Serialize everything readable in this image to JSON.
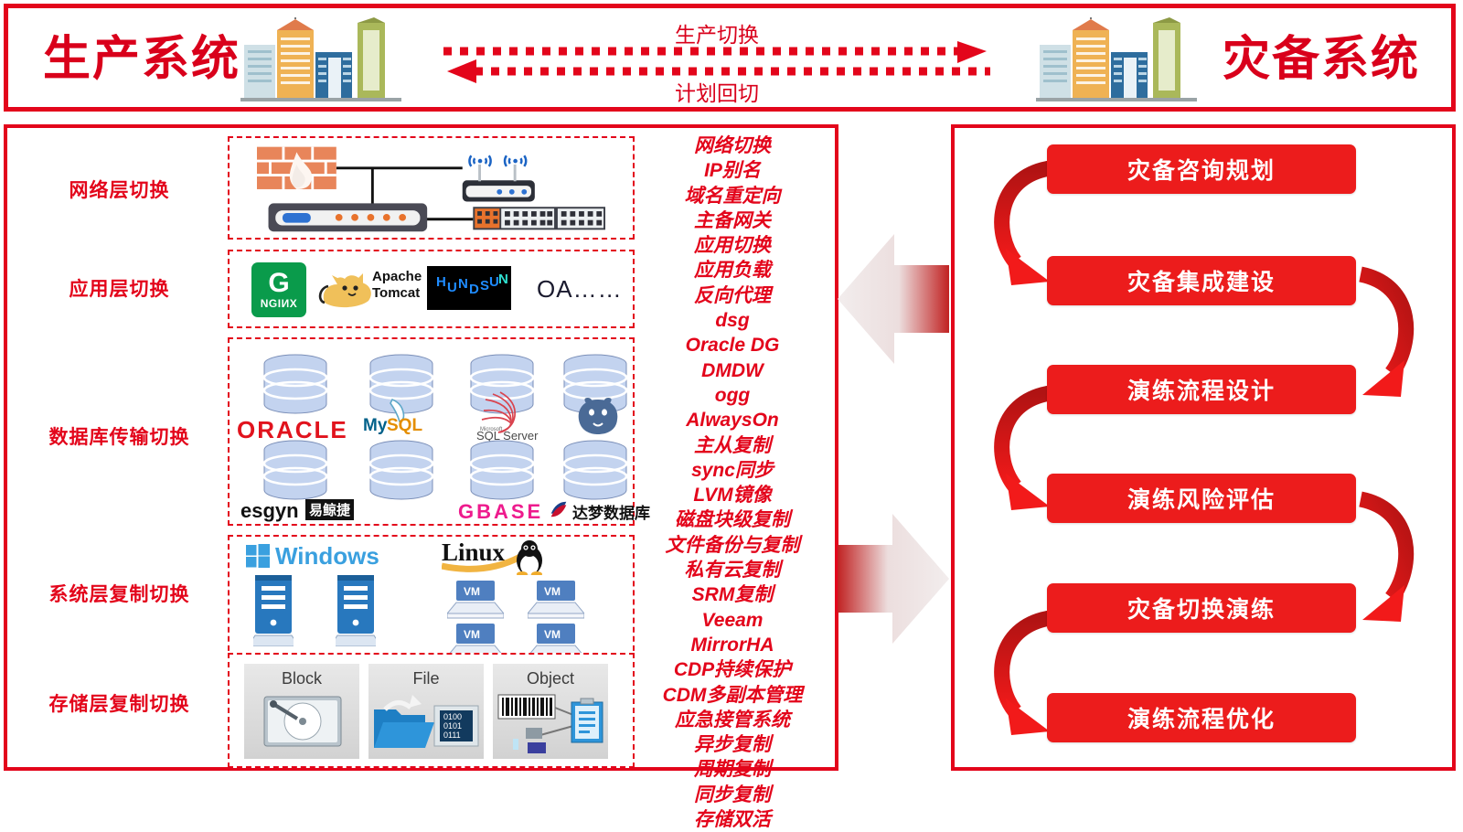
{
  "header": {
    "left_title": "生产系统",
    "right_title": "灾备系统",
    "arrow_top_label": "生产切换",
    "arrow_bottom_label": "计划回切",
    "left_icon": "city-buildings-icon",
    "right_icon": "city-buildings-icon"
  },
  "left_panel": {
    "rows": [
      {
        "label": "网络层切换"
      },
      {
        "label": "应用层切换"
      },
      {
        "label": "数据库传输切换"
      },
      {
        "label": "系统层复制切换"
      },
      {
        "label": "存储层复制切换"
      }
    ],
    "network_icons": [
      "firewall-brick-icon",
      "router-icon",
      "wireless-access-point-icon",
      "network-switch-icon"
    ],
    "app_logos": [
      {
        "name": "nginx-logo",
        "text": "NGIИX",
        "mark": "G"
      },
      {
        "name": "apache-tomcat-logo",
        "line1": "Apache",
        "line2": "Tomcat"
      },
      {
        "name": "hundsun-logo",
        "text": "HUNDSUN"
      },
      {
        "name": "oa-label",
        "text": "OA……"
      }
    ],
    "database_logos": [
      {
        "name": "oracle-logo",
        "text": "ORACLE"
      },
      {
        "name": "mysql-logo",
        "text": "MySQL"
      },
      {
        "name": "sqlserver-logo",
        "text": "SQL Server",
        "sup": "Microsoft"
      },
      {
        "name": "postgresql-logo",
        "text": ""
      },
      {
        "name": "esgyn-logo",
        "text": "esgyn",
        "cn": "易鲸捷"
      },
      {
        "name": "gbase-logo",
        "text": "GBASE"
      },
      {
        "name": "dameng-logo",
        "text": "达梦数据库"
      }
    ],
    "system_logos": [
      {
        "name": "windows-logo",
        "text": "Windows"
      },
      {
        "name": "linux-logo",
        "text": "Linux"
      },
      {
        "name": "vm-label",
        "text": "VM"
      }
    ],
    "storage_cards": [
      {
        "name": "block-storage-card",
        "text": "Block"
      },
      {
        "name": "file-storage-card",
        "text": "File"
      },
      {
        "name": "object-storage-card",
        "text": "Object"
      }
    ],
    "storage_binary": [
      "0100",
      "0101",
      "0111"
    ]
  },
  "middle_column": {
    "items": [
      "网络切换",
      "IP别名",
      "域名重定向",
      "主备网关",
      "应用切换",
      "应用负载",
      "反向代理",
      "dsg",
      "Oracle DG",
      "DMDW",
      "ogg",
      "AlwaysOn",
      "主从复制",
      "sync同步",
      "LVM镜像",
      "磁盘块级复制",
      "文件备份与复制",
      "私有云复制",
      "SRM复制",
      "Veeam",
      "MirrorHA",
      "CDP持续保护",
      "CDM多副本管理",
      "应急接管系统",
      "异步复制",
      "周期复制",
      "同步复制",
      "存储双活"
    ]
  },
  "right_panel": {
    "steps": [
      "灾备咨询规划",
      "灾备集成建设",
      "演练流程设计",
      "演练风险评估",
      "灾备切换演练",
      "演练流程优化"
    ]
  },
  "colors": {
    "brand_red": "#e3051b",
    "box_red": "#ec1c1c",
    "text_red": "#d9001b"
  }
}
